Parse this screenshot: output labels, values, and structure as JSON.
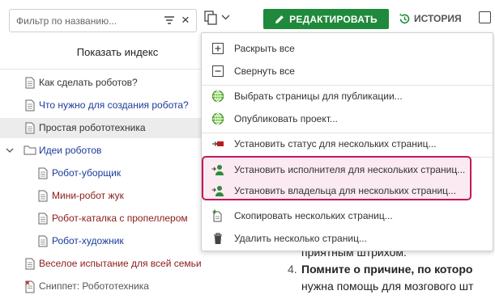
{
  "filter": {
    "placeholder": "Фильтр по названию..."
  },
  "show_index": "Показать индекс",
  "tree": [
    {
      "label": "Как сделать роботов?"
    },
    {
      "label": "Что нужно для создания робота?"
    },
    {
      "label": "Простая робототехника"
    },
    {
      "label": "Идеи роботов"
    },
    {
      "label": "Робот-уборщик"
    },
    {
      "label": "Мини-робот жук"
    },
    {
      "label": "Робот-каталка с пропеллером"
    },
    {
      "label": "Робот-художник"
    },
    {
      "label": "Веселое испытание для всей семьи"
    },
    {
      "label": "Сниппет: Робототехника"
    }
  ],
  "toolbar": {
    "edit_label": "РЕДАКТИРОВАТЬ",
    "history_label": "ИСТОРИЯ"
  },
  "menu": {
    "items": [
      {
        "label": "Раскрыть все",
        "icon": "expand-all-icon"
      },
      {
        "label": "Свернуть все",
        "icon": "collapse-all-icon"
      },
      {
        "label": "Выбрать страницы для публикации...",
        "icon": "globe-icon"
      },
      {
        "label": "Опубликовать проект...",
        "icon": "globe-icon"
      },
      {
        "label": "Установить статус для нескольких страниц...",
        "icon": "status-flag-icon"
      },
      {
        "label": "Установить исполнителя для нескольких страниц...",
        "icon": "assign-user-icon"
      },
      {
        "label": "Установить владельца для нескольких страниц...",
        "icon": "assign-user-icon"
      },
      {
        "label": "Скопировать нескольких страниц...",
        "icon": "copy-pages-icon"
      },
      {
        "label": "Удалить несколько страниц...",
        "icon": "trash-icon"
      }
    ]
  },
  "content": {
    "frag1": "приятным штрихом.",
    "list_num": "4.",
    "item4_bold": "Помните о причине, по которо",
    "item4_rest": "нужна помощь для мозгового шт"
  },
  "colors": {
    "accent_green": "#1f8a3b",
    "highlight": "#c2185b"
  }
}
